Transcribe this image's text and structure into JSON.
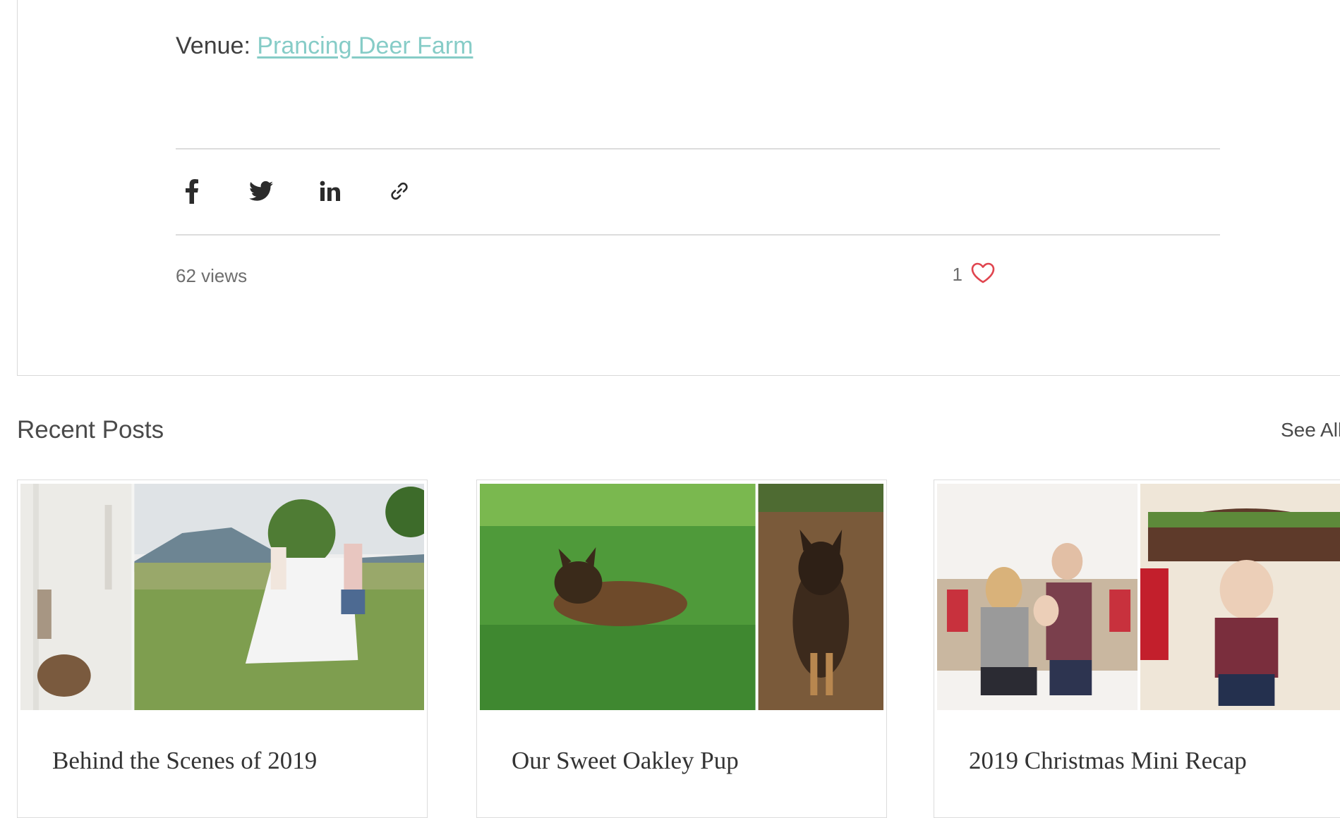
{
  "venue": {
    "label": "Venue: ",
    "link_text": "Prancing Deer Farm "
  },
  "share": {
    "icons": [
      "facebook-icon",
      "twitter-icon",
      "linkedin-icon",
      "link-icon"
    ]
  },
  "stats": {
    "views": "62 views",
    "likes": "1"
  },
  "recent": {
    "title": "Recent Posts",
    "see_all": "See All",
    "posts": [
      {
        "title": "Behind the Scenes of 2019"
      },
      {
        "title": "Our Sweet Oakley Pup"
      },
      {
        "title": "2019 Christmas Mini Recap"
      }
    ]
  },
  "colors": {
    "link": "#86ccc7",
    "heart": "#e0454f",
    "text": "#3f3f3f",
    "divider": "#dcdcdc"
  }
}
